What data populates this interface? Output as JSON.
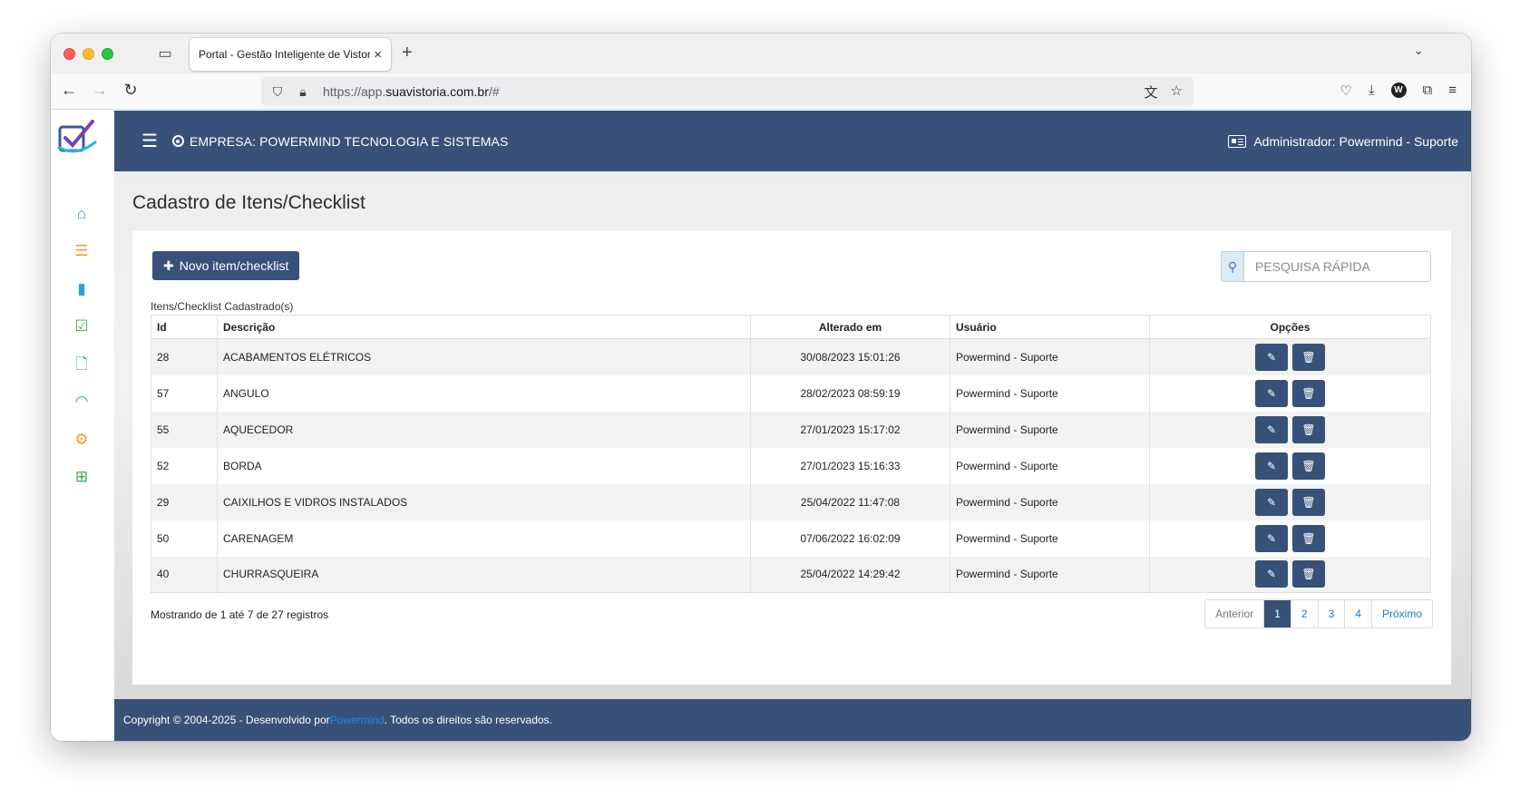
{
  "browser": {
    "tab_title": "Portal - Gestão Inteligente de Vistor",
    "url_prefix": "https://app.",
    "url_domain": "suavistoria.com.br",
    "url_suffix": "/#"
  },
  "topbar": {
    "company": "EMPRESA: POWERMIND TECNOLOGIA E SISTEMAS",
    "admin": "Administrador: Powermind - Suporte"
  },
  "page": {
    "title": "Cadastro de Itens/Checklist",
    "new_button": "Novo item/checklist",
    "search_placeholder": "PESQUISA RÁPIDA",
    "caption": "Itens/Checklist Cadastrado(s)"
  },
  "table": {
    "headers": [
      "Id",
      "Descrição",
      "Alterado em",
      "Usuário",
      "Opções"
    ],
    "rows": [
      {
        "id": "28",
        "desc": "ACABAMENTOS ELÉTRICOS",
        "date": "30/08/2023 15:01:26",
        "user": "Powermind - Suporte"
      },
      {
        "id": "57",
        "desc": "ANGULO",
        "date": "28/02/2023 08:59:19",
        "user": "Powermind - Suporte"
      },
      {
        "id": "55",
        "desc": "AQUECEDOR",
        "date": "27/01/2023 15:17:02",
        "user": "Powermind - Suporte"
      },
      {
        "id": "52",
        "desc": "BORDA",
        "date": "27/01/2023 15:16:33",
        "user": "Powermind - Suporte"
      },
      {
        "id": "29",
        "desc": "CAIXILHOS E VIDROS INSTALADOS",
        "date": "25/04/2022 11:47:08",
        "user": "Powermind - Suporte"
      },
      {
        "id": "50",
        "desc": "CARENAGEM",
        "date": "07/06/2022 16:02:09",
        "user": "Powermind - Suporte"
      },
      {
        "id": "40",
        "desc": "CHURRASQUEIRA",
        "date": "25/04/2022 14:29:42",
        "user": "Powermind - Suporte"
      }
    ]
  },
  "summary": "Mostrando de 1 até 7 de 27 registros",
  "pagination": {
    "prev": "Anterior",
    "pages": [
      "1",
      "2",
      "3",
      "4"
    ],
    "next": "Próximo",
    "active_page": "1"
  },
  "footer": {
    "prefix": "Copyright © 2004-2025 - Desenvolvido por ",
    "brand": "Powermind",
    "suffix": ". Todos os direitos são reservados."
  },
  "icons": {
    "sidebar": [
      "home-icon",
      "list-icon",
      "building-icon",
      "calendar-check-icon",
      "document-icon",
      "gauge-icon",
      "gear-icon",
      "medkit-icon"
    ],
    "sidebar_colors": [
      "#2b9fd9",
      "#f0a030",
      "#2b9fd9",
      "#3aa856",
      "#2b9fd9",
      "#2b9fd9",
      "#f0a030",
      "#3aa856"
    ]
  },
  "colors": {
    "primary": "#385178",
    "link": "#1e7bc8"
  }
}
